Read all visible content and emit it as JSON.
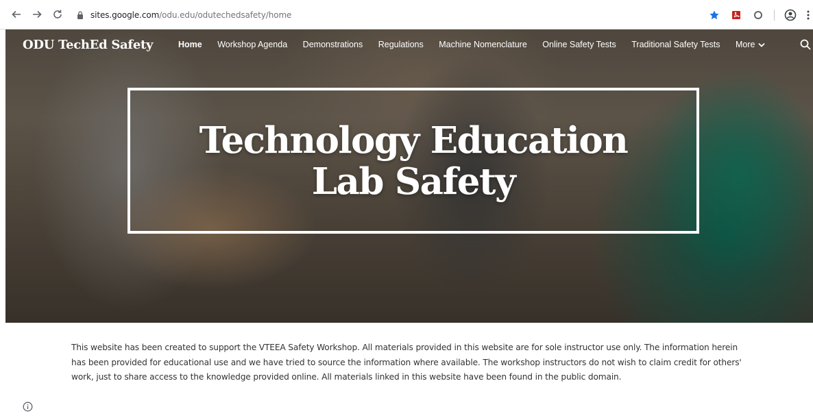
{
  "browser": {
    "url_host": "sites.google.com",
    "url_path": "/odu.edu/odutechedsafety/home",
    "icons": [
      "back-icon",
      "forward-icon",
      "reload-icon",
      "lock-icon",
      "bookmark-star-icon",
      "pdf-extension-icon",
      "extension-circle-icon",
      "profile-icon",
      "menu-dots-icon"
    ],
    "accent_color": "#1a73e8"
  },
  "site": {
    "title": "ODU TechEd Safety",
    "nav": [
      {
        "label": "Home",
        "active": true
      },
      {
        "label": "Workshop Agenda"
      },
      {
        "label": "Demonstrations"
      },
      {
        "label": "Regulations"
      },
      {
        "label": "Machine Nomenclature"
      },
      {
        "label": "Online Safety Tests"
      },
      {
        "label": "Traditional Safety Tests"
      },
      {
        "label": "More"
      }
    ]
  },
  "hero": {
    "line1": "Technology Education",
    "line2": "Lab Safety"
  },
  "content": {
    "paragraph": "This website has been created to support the VTEEA Safety Workshop.  All materials provided in this website are for sole instructor use only.  The information herein has been provided for educational use and we have tried to source the information where available.  The workshop instructors do not wish to claim credit for others' work, just to share access to the knowledge provided online.  All materials linked in this website have been found in the public domain."
  }
}
